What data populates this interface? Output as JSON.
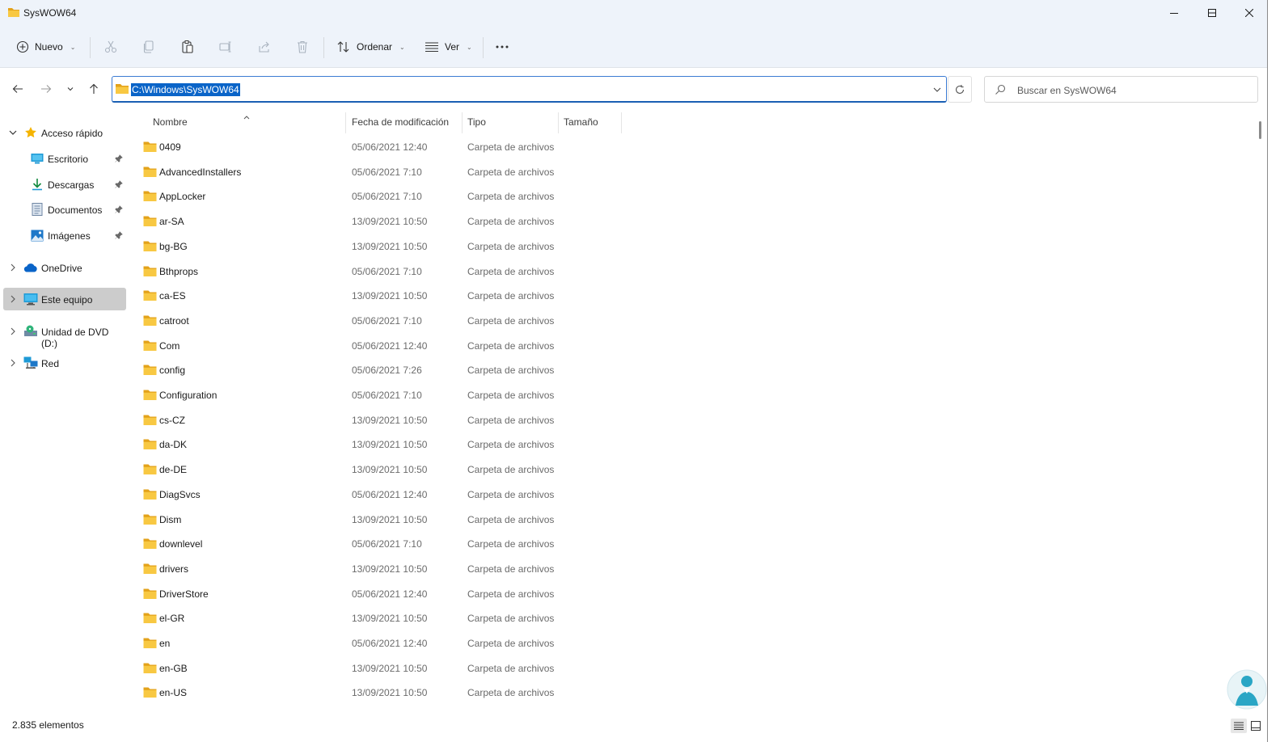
{
  "window": {
    "title": "SysWOW64",
    "controls": [
      "minimize",
      "maximize",
      "close"
    ]
  },
  "toolbar": {
    "new_label": "Nuevo",
    "sort_label": "Ordenar",
    "view_label": "Ver",
    "icons": [
      "add-circle-icon",
      "cut-icon",
      "copy-icon",
      "paste-icon",
      "rename-icon",
      "share-icon",
      "delete-icon",
      "sort-icon",
      "view-icon",
      "more-icon"
    ]
  },
  "address": {
    "path": "C:\\Windows\\SysWOW64",
    "search_placeholder": "Buscar en SysWOW64"
  },
  "nav": {
    "quick_access": "Acceso rápido",
    "items": [
      {
        "label": "Escritorio",
        "icon": "desktop-icon",
        "pinned": true
      },
      {
        "label": "Descargas",
        "icon": "download-icon",
        "pinned": true
      },
      {
        "label": "Documentos",
        "icon": "document-icon",
        "pinned": true
      },
      {
        "label": "Imágenes",
        "icon": "image-icon",
        "pinned": true
      }
    ],
    "onedrive": "OneDrive",
    "this_pc": "Este equipo",
    "dvd": "Unidad de DVD (D:)",
    "network": "Red"
  },
  "columns": {
    "name": "Nombre",
    "date": "Fecha de modificación",
    "type": "Tipo",
    "size": "Tamaño"
  },
  "files": [
    {
      "name": "0409",
      "date": "05/06/2021 12:40",
      "type": "Carpeta de archivos"
    },
    {
      "name": "AdvancedInstallers",
      "date": "05/06/2021 7:10",
      "type": "Carpeta de archivos"
    },
    {
      "name": "AppLocker",
      "date": "05/06/2021 7:10",
      "type": "Carpeta de archivos"
    },
    {
      "name": "ar-SA",
      "date": "13/09/2021 10:50",
      "type": "Carpeta de archivos"
    },
    {
      "name": "bg-BG",
      "date": "13/09/2021 10:50",
      "type": "Carpeta de archivos"
    },
    {
      "name": "Bthprops",
      "date": "05/06/2021 7:10",
      "type": "Carpeta de archivos"
    },
    {
      "name": "ca-ES",
      "date": "13/09/2021 10:50",
      "type": "Carpeta de archivos"
    },
    {
      "name": "catroot",
      "date": "05/06/2021 7:10",
      "type": "Carpeta de archivos"
    },
    {
      "name": "Com",
      "date": "05/06/2021 12:40",
      "type": "Carpeta de archivos"
    },
    {
      "name": "config",
      "date": "05/06/2021 7:26",
      "type": "Carpeta de archivos"
    },
    {
      "name": "Configuration",
      "date": "05/06/2021 7:10",
      "type": "Carpeta de archivos"
    },
    {
      "name": "cs-CZ",
      "date": "13/09/2021 10:50",
      "type": "Carpeta de archivos"
    },
    {
      "name": "da-DK",
      "date": "13/09/2021 10:50",
      "type": "Carpeta de archivos"
    },
    {
      "name": "de-DE",
      "date": "13/09/2021 10:50",
      "type": "Carpeta de archivos"
    },
    {
      "name": "DiagSvcs",
      "date": "05/06/2021 12:40",
      "type": "Carpeta de archivos"
    },
    {
      "name": "Dism",
      "date": "13/09/2021 10:50",
      "type": "Carpeta de archivos"
    },
    {
      "name": "downlevel",
      "date": "05/06/2021 7:10",
      "type": "Carpeta de archivos"
    },
    {
      "name": "drivers",
      "date": "13/09/2021 10:50",
      "type": "Carpeta de archivos"
    },
    {
      "name": "DriverStore",
      "date": "05/06/2021 12:40",
      "type": "Carpeta de archivos"
    },
    {
      "name": "el-GR",
      "date": "13/09/2021 10:50",
      "type": "Carpeta de archivos"
    },
    {
      "name": "en",
      "date": "05/06/2021 12:40",
      "type": "Carpeta de archivos"
    },
    {
      "name": "en-GB",
      "date": "13/09/2021 10:50",
      "type": "Carpeta de archivos"
    },
    {
      "name": "en-US",
      "date": "13/09/2021 10:50",
      "type": "Carpeta de archivos"
    }
  ],
  "status": {
    "item_count": "2.835 elementos"
  },
  "colors": {
    "accent": "#0a64c8",
    "folder": "#f8c842",
    "folder_dark": "#e3a21a",
    "chrome_bg": "#eef3fa",
    "selected_nav": "#cccccc"
  }
}
